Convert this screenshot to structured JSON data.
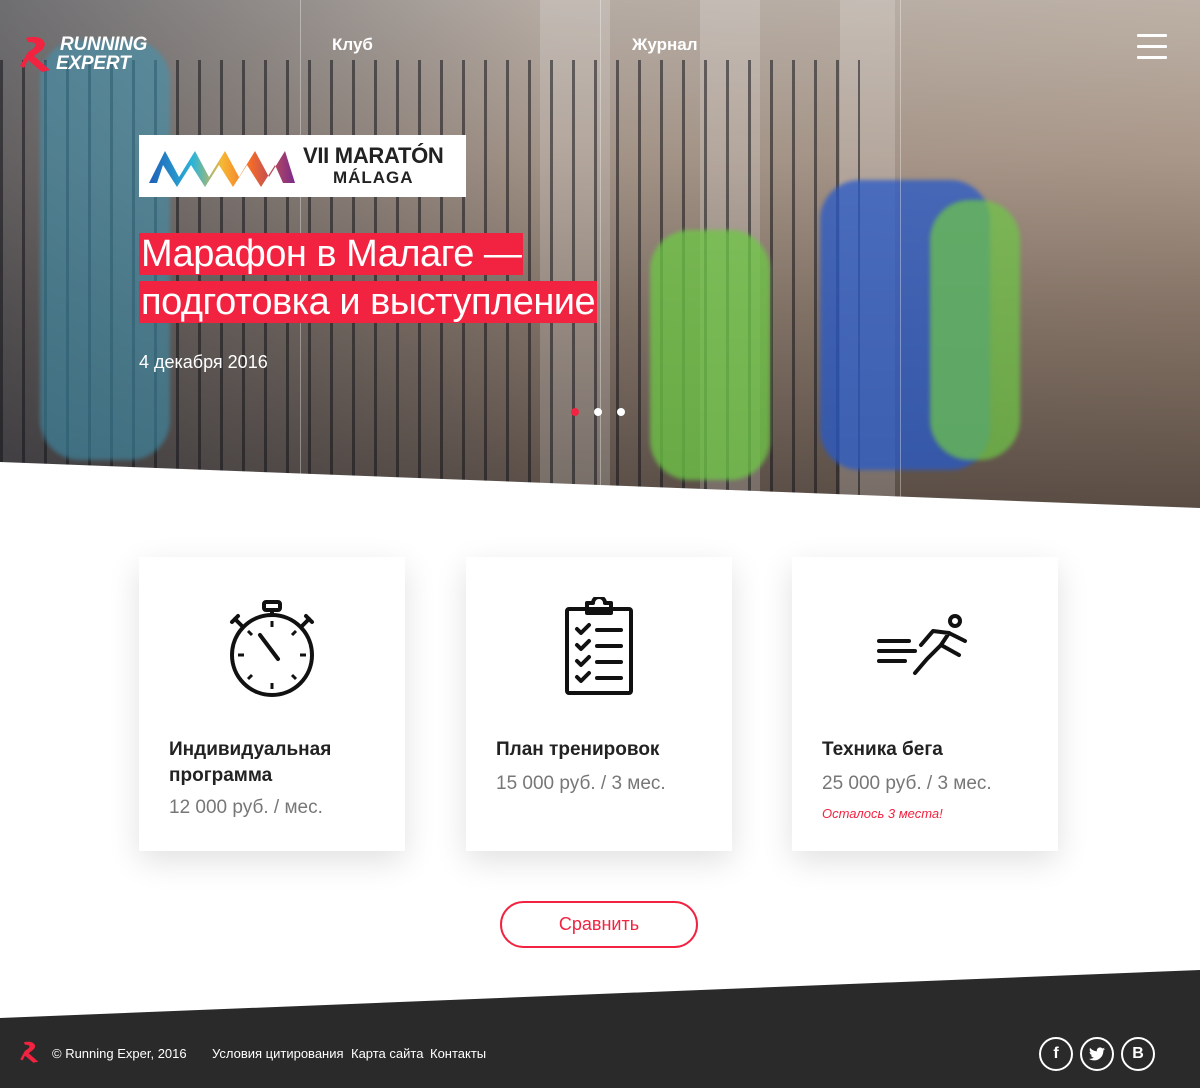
{
  "brand": {
    "line1": "RUNNING",
    "line2": "EXPERT",
    "accent": "#f22340"
  },
  "nav": {
    "club": "Клуб",
    "journal": "Журнал"
  },
  "hero": {
    "event_line1": "VII MARATÓN",
    "event_line2": "MÁLAGA",
    "title": "Марафон в Малаге — подготовка и выступление",
    "date": "4 декабря 2016",
    "slides": 3,
    "active_slide": 1
  },
  "cards": [
    {
      "title": "Индивидуальная программа",
      "price": "12 000 руб. / мес.",
      "icon": "stopwatch-icon"
    },
    {
      "title": "План тренировок",
      "price": "15 000 руб. / 3 мес.",
      "icon": "clipboard-checklist-icon"
    },
    {
      "title": "Техника бега",
      "price": "25 000 руб. / 3 мес.",
      "note": "Осталось 3 места!",
      "icon": "runner-icon"
    }
  ],
  "compare_label": "Сравнить",
  "footer": {
    "copyright": "© Running Exper, 2016",
    "links": [
      "Условия цитирования",
      "Карта сайта",
      "Контакты"
    ],
    "social": [
      "f",
      "t",
      "B"
    ],
    "background": "#2a2a2a"
  }
}
